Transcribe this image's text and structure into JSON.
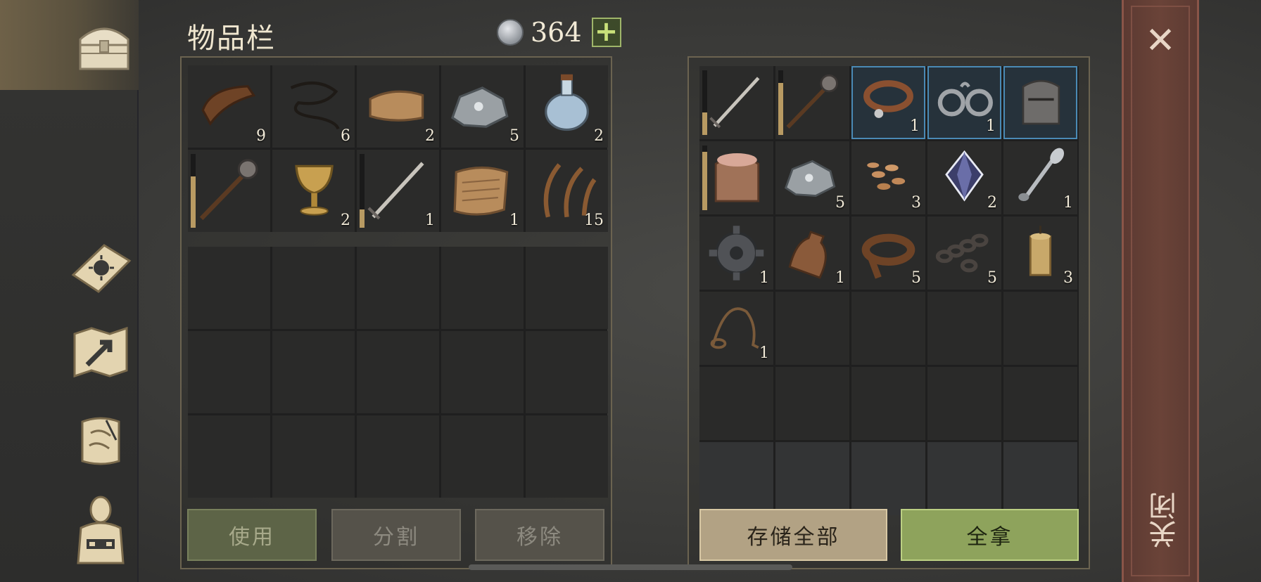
{
  "header": {
    "title": "物品栏",
    "currency_value": "364",
    "plus_label": "+"
  },
  "sidebar": {
    "items": [
      {
        "name": "chest",
        "icon": "chest-icon"
      },
      {
        "name": "recipes",
        "icon": "sun-book-icon"
      },
      {
        "name": "map",
        "icon": "map-icon"
      },
      {
        "name": "quests",
        "icon": "scroll-icon"
      },
      {
        "name": "character",
        "icon": "character-icon"
      }
    ]
  },
  "inventory": {
    "slots": [
      {
        "icon": "leather-icon",
        "count": "9"
      },
      {
        "icon": "rope-icon",
        "count": "6"
      },
      {
        "icon": "cloth-icon",
        "count": "2"
      },
      {
        "icon": "iron-ore-icon",
        "count": "5"
      },
      {
        "icon": "potion-icon",
        "count": "2"
      },
      {
        "icon": "mace-icon",
        "count": "",
        "durability": 0.7
      },
      {
        "icon": "goblet-icon",
        "count": "2"
      },
      {
        "icon": "sword-icon",
        "count": "1",
        "durability": 0.25
      },
      {
        "icon": "parchment-icon",
        "count": "1"
      },
      {
        "icon": "fiber-icon",
        "count": "15"
      }
    ]
  },
  "storage": {
    "slots": [
      {
        "icon": "sword-icon",
        "count": "",
        "durability": 0.35
      },
      {
        "icon": "mace-icon",
        "count": "",
        "durability": 0.8
      },
      {
        "icon": "collar-icon",
        "count": "1",
        "highlight": true
      },
      {
        "icon": "shackles-icon",
        "count": "1",
        "highlight": true
      },
      {
        "icon": "great-helm-icon",
        "count": "",
        "highlight": true
      },
      {
        "icon": "leather-helm-icon",
        "count": "",
        "durability": 0.9
      },
      {
        "icon": "iron-ore-icon",
        "count": "5"
      },
      {
        "icon": "seeds-icon",
        "count": "3"
      },
      {
        "icon": "crystal-icon",
        "count": "2"
      },
      {
        "icon": "spoon-icon",
        "count": "1"
      },
      {
        "icon": "gear-icon",
        "count": "1"
      },
      {
        "icon": "flask-icon",
        "count": "1"
      },
      {
        "icon": "leather-strap-icon",
        "count": "5"
      },
      {
        "icon": "chain-icon",
        "count": "5"
      },
      {
        "icon": "candle-icon",
        "count": "3"
      },
      {
        "icon": "lasso-icon",
        "count": "1"
      }
    ]
  },
  "buttons": {
    "use": "使用",
    "split": "分割",
    "remove": "移除",
    "store_all": "存储全部",
    "take_all": "全拿"
  },
  "close": {
    "x": "✕",
    "label": "关闭"
  },
  "colors": {
    "accent_green": "#8ea35c",
    "close_red": "#6a4338",
    "highlight_blue": "#4a8ab5"
  }
}
